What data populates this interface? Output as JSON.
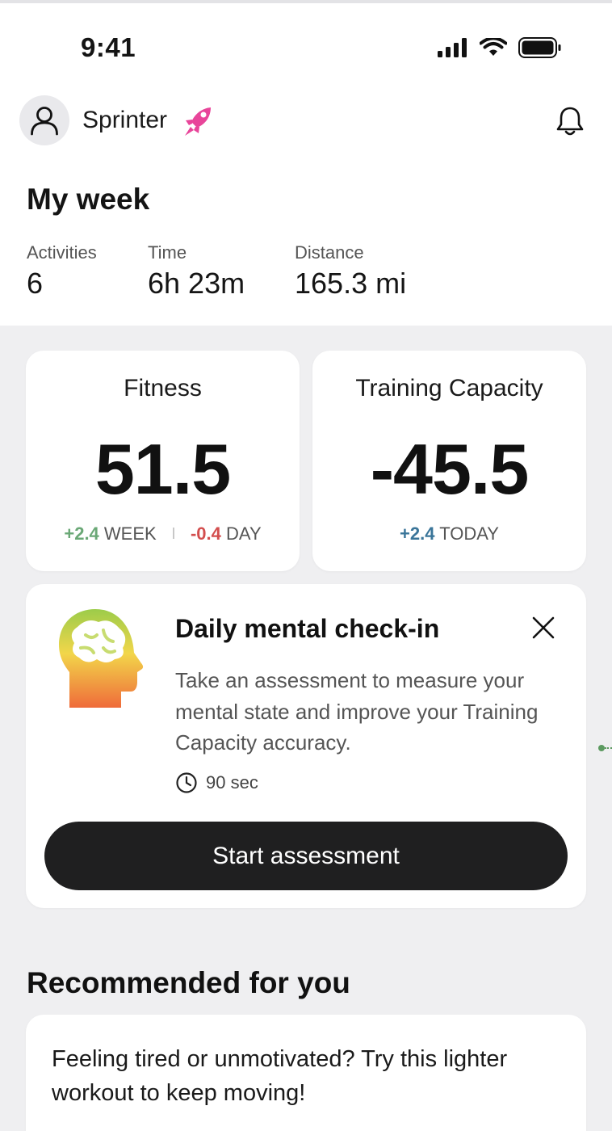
{
  "status_bar": {
    "time": "9:41"
  },
  "profile": {
    "name": "Sprinter"
  },
  "week": {
    "title": "My week",
    "stats": [
      {
        "label": "Activities",
        "value": "6"
      },
      {
        "label": "Time",
        "value": "6h 23m"
      },
      {
        "label": "Distance",
        "value": "165.3 mi"
      }
    ]
  },
  "fitness": {
    "title": "Fitness",
    "value": "51.5",
    "week_delta": "+2.4",
    "week_label": "WEEK",
    "day_delta": "-0.4",
    "day_label": "DAY"
  },
  "training_capacity": {
    "title": "Training Capacity",
    "value": "-45.5",
    "today_delta": "+2.4",
    "today_label": "TODAY"
  },
  "checkin": {
    "title": "Daily mental check-in",
    "description": "Take an assessment to measure your mental state and improve your Training Capacity accuracy.",
    "duration": "90 sec",
    "button_label": "Start assessment"
  },
  "recommended": {
    "title": "Recommended for you",
    "text": "Feeling tired or unmotivated? Try this lighter workout to keep moving!"
  },
  "colors": {
    "positive": "#6aa876",
    "negative": "#d34e4e",
    "neutral_blue": "#3a7599",
    "button_bg": "#1f1f20",
    "accent_pink": "#e8459a"
  }
}
